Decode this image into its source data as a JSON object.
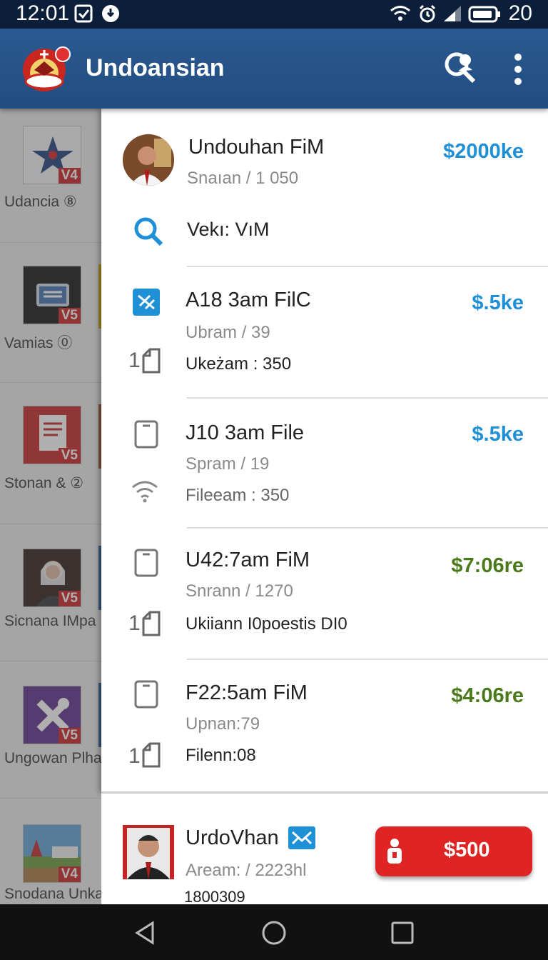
{
  "status_bar": {
    "time": "12:01",
    "battery_level": "20",
    "icons": [
      "checkbox-icon",
      "download-icon",
      "wifi-icon",
      "alarm-icon",
      "signal-icon",
      "battery-icon"
    ]
  },
  "app_bar": {
    "title": "Undoansian",
    "icons": [
      "app-logo",
      "search-person-icon",
      "more-vert-icon"
    ]
  },
  "background_list": [
    {
      "label": "Udancia ⑧",
      "badge": "V4"
    },
    {
      "label": "Vamias ⓪",
      "badge": "V5"
    },
    {
      "label": "Stonan & ②",
      "badge": "V5"
    },
    {
      "label": "Sicnana IMpa",
      "badge": "V5"
    },
    {
      "label": "Ungowan Plha",
      "badge": "V5"
    },
    {
      "label": "Snodana Unka",
      "badge": "V4"
    }
  ],
  "drawer": {
    "profile": {
      "name": "Undouhan FiM",
      "sub": "Snaıan / 1 050",
      "price": "$2000ke",
      "search_label": "Vekı: VıM"
    },
    "items": [
      {
        "title": "A18 3am FilC",
        "sub": "Ubram / 39",
        "meta": "Ukeżam : 350",
        "price": "$.5ke",
        "price_color": "#1f8fd6",
        "icon": "app-icon",
        "meta_icon": "tablet-icon",
        "meta_prefix": "1"
      },
      {
        "title": "J10 3am File",
        "sub": "Spram / 19",
        "meta": "Fileeam : 350",
        "price": "$.5ke",
        "price_color": "#1f8fd6",
        "icon": "phone-icon",
        "meta_icon": "wifi-icon",
        "meta_prefix": ""
      },
      {
        "title": "U42:7am FiM",
        "sub": "Snrann / 1270",
        "meta": "Ukiiann I0poestis DI0",
        "price": "$7:06re",
        "price_color": "#4b7a1c",
        "icon": "phone-icon",
        "meta_icon": "tablet-icon",
        "meta_prefix": "1"
      },
      {
        "title": "F22:5am FiM",
        "sub": "Upnan:79",
        "meta": "Filenn:08",
        "price": "$4:06re",
        "price_color": "#4b7a1c",
        "icon": "phone-icon",
        "meta_icon": "tablet-icon",
        "meta_prefix": "1"
      }
    ]
  },
  "bottom_card": {
    "name": "UrdoVhan",
    "sub": "Aream: / 2223hl",
    "number": "1800309",
    "button_label": "$500"
  },
  "nav_bar": {
    "icons": [
      "back-icon",
      "home-icon",
      "recents-icon"
    ]
  }
}
